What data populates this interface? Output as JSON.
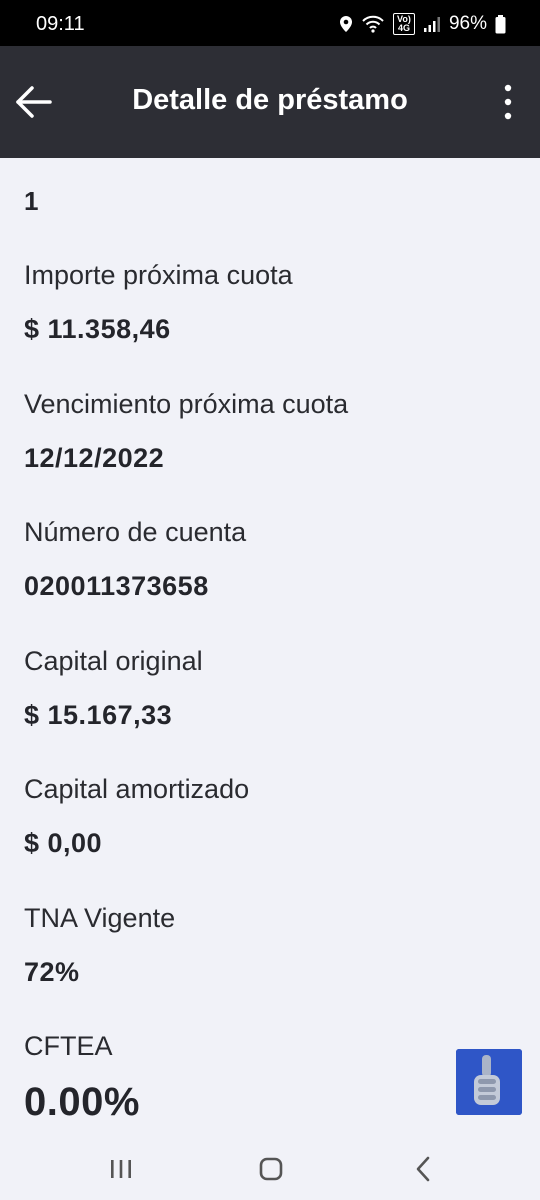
{
  "status_bar": {
    "time": "09:11",
    "network_badge": "Vo) 4G",
    "battery": "96%"
  },
  "app_bar": {
    "title": "Detalle de préstamo"
  },
  "loan": {
    "number": "1",
    "fields": [
      {
        "label": "Importe próxima cuota",
        "value": "$ 11.358,46"
      },
      {
        "label": "Vencimiento próxima cuota",
        "value": "12/12/2022"
      },
      {
        "label": "Número de cuenta",
        "value": "020011373658"
      },
      {
        "label": "Capital original",
        "value": "$ 15.167,33"
      },
      {
        "label": "Capital amortizado",
        "value": "$ 0,00"
      },
      {
        "label": "TNA Vigente",
        "value": "72%"
      },
      {
        "label": "CFTEA",
        "value": "0.00%"
      }
    ]
  },
  "fab": {
    "icon": "thumbs-up-icon",
    "color": "#2f56c7"
  },
  "colors": {
    "app_bar": "#2d2e35",
    "background": "#f1f2f8",
    "text": "#24252b"
  }
}
